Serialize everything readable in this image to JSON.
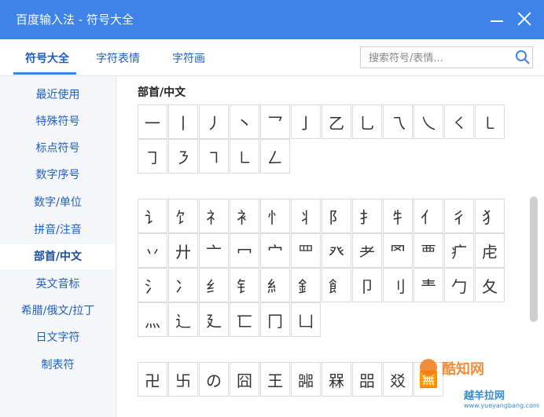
{
  "window": {
    "title": "百度输入法 - 符号大全"
  },
  "tabs": [
    {
      "label": "符号大全"
    },
    {
      "label": "字符表情"
    },
    {
      "label": "字符画"
    }
  ],
  "search": {
    "placeholder": "搜索符号/表情..."
  },
  "sidebar": {
    "items": [
      {
        "label": "最近使用"
      },
      {
        "label": "特殊符号"
      },
      {
        "label": "标点符号"
      },
      {
        "label": "数字序号"
      },
      {
        "label": "数字/单位"
      },
      {
        "label": "拼音/注音"
      },
      {
        "label": "部首/中文"
      },
      {
        "label": "英文音标"
      },
      {
        "label": "希腊/俄文/拉丁"
      },
      {
        "label": "日文字符"
      },
      {
        "label": "制表符"
      }
    ],
    "active_index": 6
  },
  "section": {
    "title": "部首/中文"
  },
  "grids": [
    {
      "symbols": [
        "一",
        "丨",
        "丿",
        "丶",
        "乛",
        "亅",
        "乙",
        "乚",
        "乁",
        "乀",
        "㇛",
        "㇄",
        "㇆",
        "㇋",
        "㇕",
        "㇗",
        "𠃋"
      ]
    },
    {
      "symbols": [
        "讠",
        "饣",
        "礻",
        "衤",
        "忄",
        "丬",
        "阝",
        "扌",
        "牜",
        "亻",
        "彳",
        "犭",
        "丷",
        "廾",
        "亠",
        "冖",
        "宀",
        "罒",
        "癶",
        "耂",
        "罓",
        "覀",
        "疒",
        "虍",
        "氵",
        "冫",
        "纟",
        "钅",
        "糹",
        "釒",
        "飠",
        "卩",
        "刂",
        "龶",
        "勹",
        "夂",
        "灬",
        "辶",
        "廴",
        "匸",
        "冂",
        "凵"
      ]
    },
    {
      "symbols": [
        "卍",
        "卐",
        "の",
        "囧",
        "王",
        "嘂",
        "槑",
        "㗊",
        "㸚",
        "🈚"
      ]
    }
  ],
  "watermarks": {
    "top": "酷知网",
    "bottom_name": "越羊拉网",
    "bottom_url": "www.yueyangbang.com"
  }
}
